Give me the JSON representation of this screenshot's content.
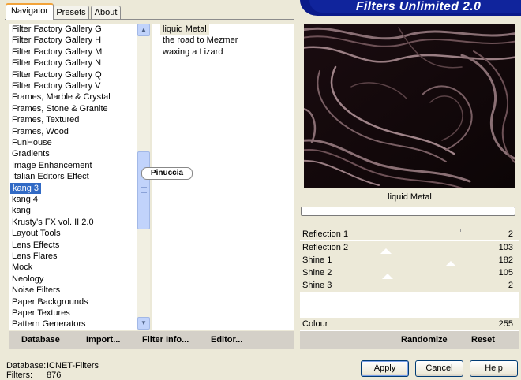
{
  "tabs": [
    {
      "label": "Navigator",
      "active": true
    },
    {
      "label": "Presets",
      "active": false
    },
    {
      "label": "About",
      "active": false
    }
  ],
  "title": "Filters Unlimited 2.0",
  "categories": [
    {
      "label": "Filter Factory Gallery G"
    },
    {
      "label": "Filter Factory Gallery H"
    },
    {
      "label": "Filter Factory Gallery M"
    },
    {
      "label": "Filter Factory Gallery N"
    },
    {
      "label": "Filter Factory Gallery Q"
    },
    {
      "label": "Filter Factory Gallery V"
    },
    {
      "label": "Frames, Marble & Crystal"
    },
    {
      "label": "Frames, Stone & Granite"
    },
    {
      "label": "Frames, Textured"
    },
    {
      "label": "Frames, Wood"
    },
    {
      "label": "FunHouse"
    },
    {
      "label": "Gradients"
    },
    {
      "label": "Image Enhancement"
    },
    {
      "label": "Italian Editors Effect"
    },
    {
      "label": "kang 3",
      "selected": true
    },
    {
      "label": "kang 4"
    },
    {
      "label": "kang"
    },
    {
      "label": "Krusty's FX vol. II 2.0"
    },
    {
      "label": "Layout Tools"
    },
    {
      "label": "Lens Effects"
    },
    {
      "label": "Lens Flares"
    },
    {
      "label": "Mock"
    },
    {
      "label": "Neology"
    },
    {
      "label": "Noise Filters"
    },
    {
      "label": "Paper Backgrounds"
    },
    {
      "label": "Paper Textures"
    },
    {
      "label": "Pattern Generators"
    }
  ],
  "filters": [
    {
      "label": "liquid Metal",
      "selected": true
    },
    {
      "label": "the road to Mezmer"
    },
    {
      "label": "waxing a Lizard"
    }
  ],
  "watermark": "Pinuccia",
  "toolbar": {
    "database": "Database",
    "import": "Import...",
    "filter_info": "Filter Info...",
    "editor": "Editor..."
  },
  "preview_filter_name": "liquid Metal",
  "parameters": [
    {
      "label": "Reflection 1",
      "value": "2"
    },
    {
      "label": "Reflection 2",
      "value": "103"
    },
    {
      "label": "Shine 1",
      "value": "182"
    },
    {
      "label": "Shine 2",
      "value": "105"
    },
    {
      "label": "Shine 3",
      "value": "2"
    },
    {
      "label": "Colour",
      "value": "255"
    }
  ],
  "right_toolbar": {
    "randomize": "Randomize",
    "reset": "Reset"
  },
  "info": {
    "database_label": "Database:",
    "database_value": "ICNET-Filters",
    "filters_label": "Filters:",
    "filters_value": "876"
  },
  "buttons": {
    "apply": "Apply",
    "cancel": "Cancel",
    "help": "Help"
  },
  "colors": {
    "selection": "#316ac5",
    "banner": "#10249c",
    "dialog_bg": "#ece9d8"
  }
}
